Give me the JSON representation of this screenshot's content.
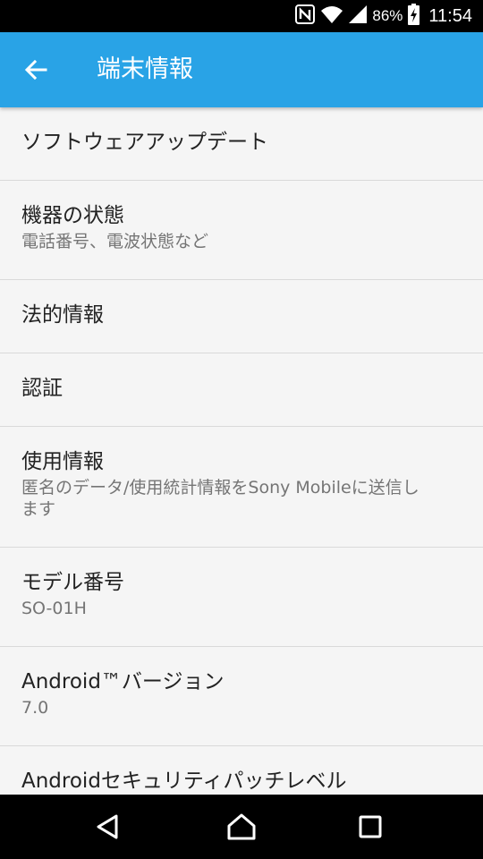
{
  "status_bar": {
    "battery_percent": "86%",
    "time": "11:54"
  },
  "app_bar": {
    "title": "端末情報"
  },
  "items": [
    {
      "title": "ソフトウェアアップデート"
    },
    {
      "title": "機器の状態",
      "subtitle": "電話番号、電波状態など"
    },
    {
      "title": "法的情報"
    },
    {
      "title": "認証"
    },
    {
      "title": "使用情報",
      "subtitle_line1": "匿名のデータ/使用統計情報をSony Mobileに送信し",
      "subtitle_line2": "ます"
    },
    {
      "title": "モデル番号",
      "subtitle": "SO-01H"
    },
    {
      "title": "Android™バージョン",
      "subtitle": "7.0"
    },
    {
      "title": "Androidセキュリティパッチレベル"
    }
  ],
  "colors": {
    "app_bar": "#29a3e6",
    "background": "#f5f5f5",
    "status_bar": "#000000"
  }
}
